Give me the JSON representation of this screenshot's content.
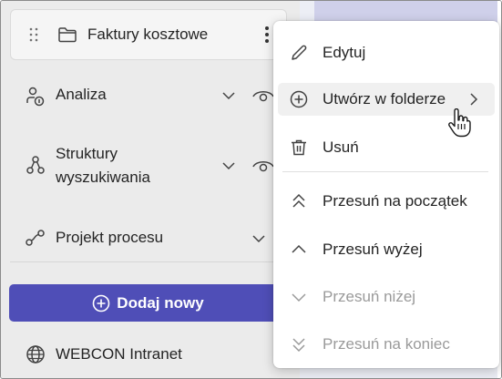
{
  "sidebar": {
    "folder": {
      "label": "Faktury kosztowe",
      "icon": "folder-icon"
    },
    "items": [
      {
        "label": "Analiza",
        "icon": "analysis-icon"
      },
      {
        "label_line1": "Struktury",
        "label_line2": "wyszukiwania",
        "icon": "structure-icon"
      },
      {
        "label": "Projekt procesu",
        "icon": "process-icon"
      }
    ],
    "add_button": "Dodaj nowy",
    "intranet": {
      "label": "WEBCON Intranet",
      "icon": "globe-icon"
    }
  },
  "context_menu": {
    "items": [
      {
        "label": "Edytuj",
        "icon": "pencil-icon",
        "disabled": false
      },
      {
        "label": "Utwórz w folderze",
        "icon": "add-circle-icon",
        "disabled": false,
        "submenu": true,
        "hovered": true
      },
      {
        "label": "Usuń",
        "icon": "trash-icon",
        "disabled": false
      },
      {
        "label": "Przesuń na początek",
        "icon": "double-chevron-up-icon",
        "disabled": false
      },
      {
        "label": "Przesuń wyżej",
        "icon": "chevron-up-icon",
        "disabled": false
      },
      {
        "label": "Przesuń niżej",
        "icon": "chevron-down-icon",
        "disabled": true
      },
      {
        "label": "Przesuń na koniec",
        "icon": "double-chevron-down-icon",
        "disabled": true
      }
    ]
  },
  "colors": {
    "accent": "#4f4eb7",
    "sidebar_bg": "#ebebeb",
    "menu_bg": "#ffffff",
    "disabled_text": "#9a9a9a"
  }
}
